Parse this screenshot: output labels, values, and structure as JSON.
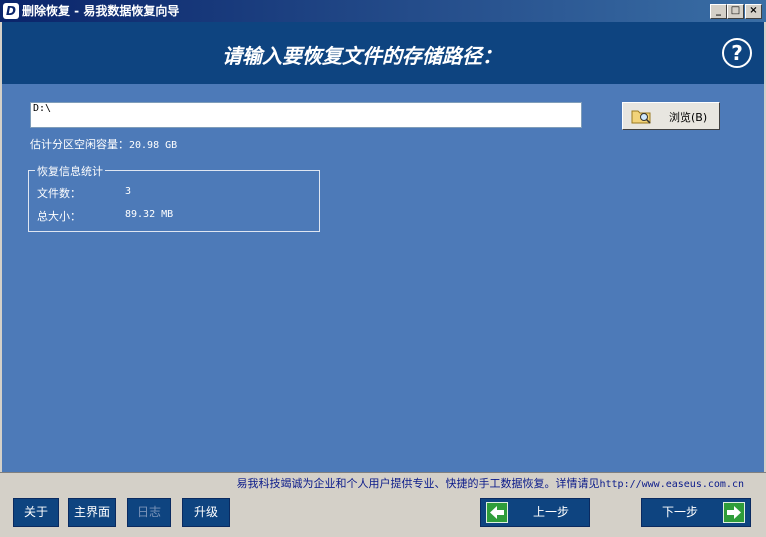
{
  "window": {
    "title": "删除恢复 - 易我数据恢复向导",
    "icon_letter": "D",
    "minimize": "_",
    "maximize": "□",
    "close": "×"
  },
  "header": {
    "title": "请输入要恢复文件的存储路径：",
    "help": "?"
  },
  "path": {
    "value": "D:\\",
    "browse_label": "浏览(B)"
  },
  "free_space": {
    "label": "估计分区空闲容量：",
    "value": "20.98 GB"
  },
  "stats": {
    "legend": "恢复信息统计",
    "file_count_label": "文件数：",
    "file_count_value": "3",
    "total_size_label": "总大小：",
    "total_size_value": "89.32 MB"
  },
  "footer": {
    "note": "易我科技竭诚为企业和个人用户提供专业、快捷的手工数据恢复。详情请见",
    "url": "http://www.easeus.com.cn"
  },
  "buttons": {
    "about": "关于",
    "main": "主界面",
    "log": "日志",
    "upgrade": "升级",
    "prev": "上一步",
    "next": "下一步"
  },
  "colors": {
    "header": "#0e4480",
    "content": "#4d7ab8",
    "button": "#0e4480",
    "arrow": "#2f9d3a"
  }
}
